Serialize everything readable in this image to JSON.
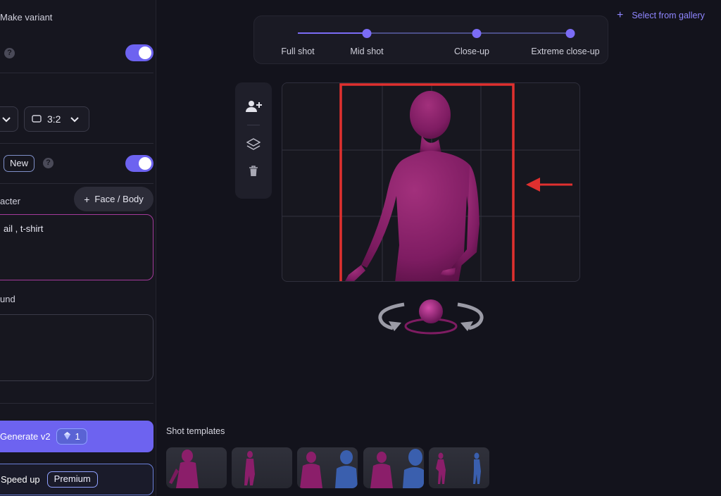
{
  "left_panel": {
    "make_variant": "Make variant",
    "aspect_ratio": "3:2",
    "new_badge": "New",
    "character_label": "acter",
    "face_body_button": "Face / Body",
    "character_prompt": "ail , t-shirt",
    "background_label": "und",
    "background_prompt": "",
    "generate_label": "Generate v2",
    "generate_credits": "1",
    "speed_up_label": "Speed up",
    "premium_badge": "Premium"
  },
  "shot_slider": {
    "stops": [
      "Full shot",
      "Mid shot",
      "Close-up",
      "Extreme close-up"
    ],
    "selected_index": 1
  },
  "gallery": {
    "label": "Select from gallery"
  },
  "templates": {
    "title": "Shot templates",
    "count": 5
  },
  "colors": {
    "accent": "#6d63f0",
    "figure": "#8b1e6a",
    "highlight_box": "#e0302f",
    "background": "#13131c"
  }
}
